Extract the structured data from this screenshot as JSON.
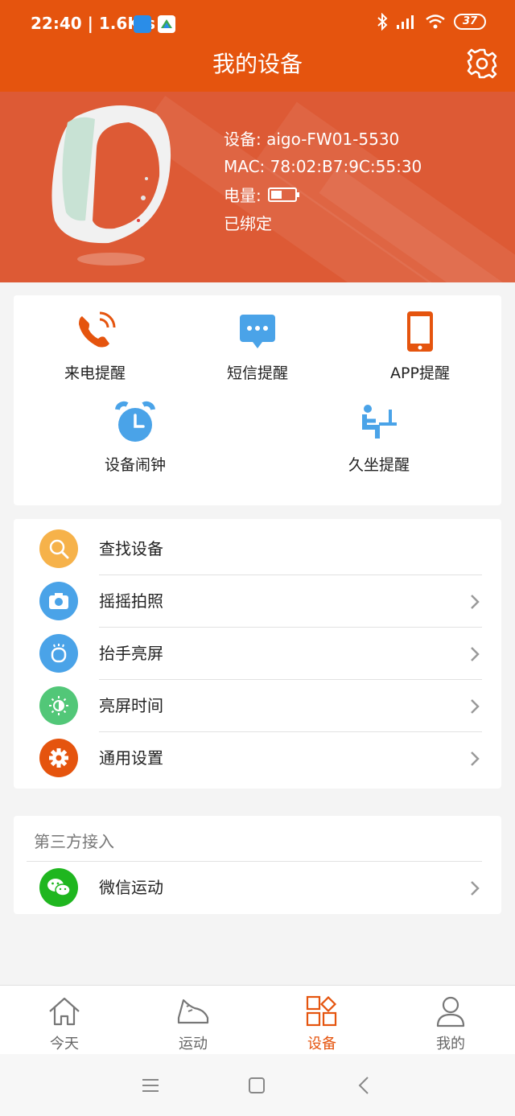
{
  "status_bar": {
    "time_speed": "22:40 | 1.6K/s",
    "battery": "37"
  },
  "header": {
    "title": "我的设备"
  },
  "device": {
    "name_label": "设备: aigo-FW01-5530",
    "mac_label": "MAC: 78:02:B7:9C:55:30",
    "battery_label": "电量:",
    "status": "已绑定"
  },
  "features": [
    {
      "label": "来电提醒",
      "icon": "phone-ring-icon"
    },
    {
      "label": "短信提醒",
      "icon": "message-icon"
    },
    {
      "label": "APP提醒",
      "icon": "smartphone-icon"
    },
    {
      "label": "设备闹钟",
      "icon": "alarm-clock-icon"
    },
    {
      "label": "久坐提醒",
      "icon": "sitting-icon"
    }
  ],
  "menu": [
    {
      "label": "查找设备",
      "icon": "search-icon",
      "color": "#f6b24a"
    },
    {
      "label": "摇摇拍照",
      "icon": "camera-icon",
      "color": "#4aa3e8"
    },
    {
      "label": "抬手亮屏",
      "icon": "wrist-icon",
      "color": "#4aa3e8"
    },
    {
      "label": "亮屏时间",
      "icon": "brightness-icon",
      "color": "#52c778"
    },
    {
      "label": "通用设置",
      "icon": "gear-icon",
      "color": "#e5540e"
    }
  ],
  "third_party": {
    "title": "第三方接入",
    "items": [
      {
        "label": "微信运动",
        "icon": "wechat-icon",
        "color": "#1fb61f"
      }
    ]
  },
  "tabs": [
    {
      "label": "今天",
      "icon": "home-icon"
    },
    {
      "label": "运动",
      "icon": "sneaker-icon"
    },
    {
      "label": "设备",
      "icon": "grid-icon"
    },
    {
      "label": "我的",
      "icon": "user-icon"
    }
  ],
  "active_tab": "设备",
  "colors": {
    "brand": "#e5540e",
    "banner": "#dd5a35"
  }
}
